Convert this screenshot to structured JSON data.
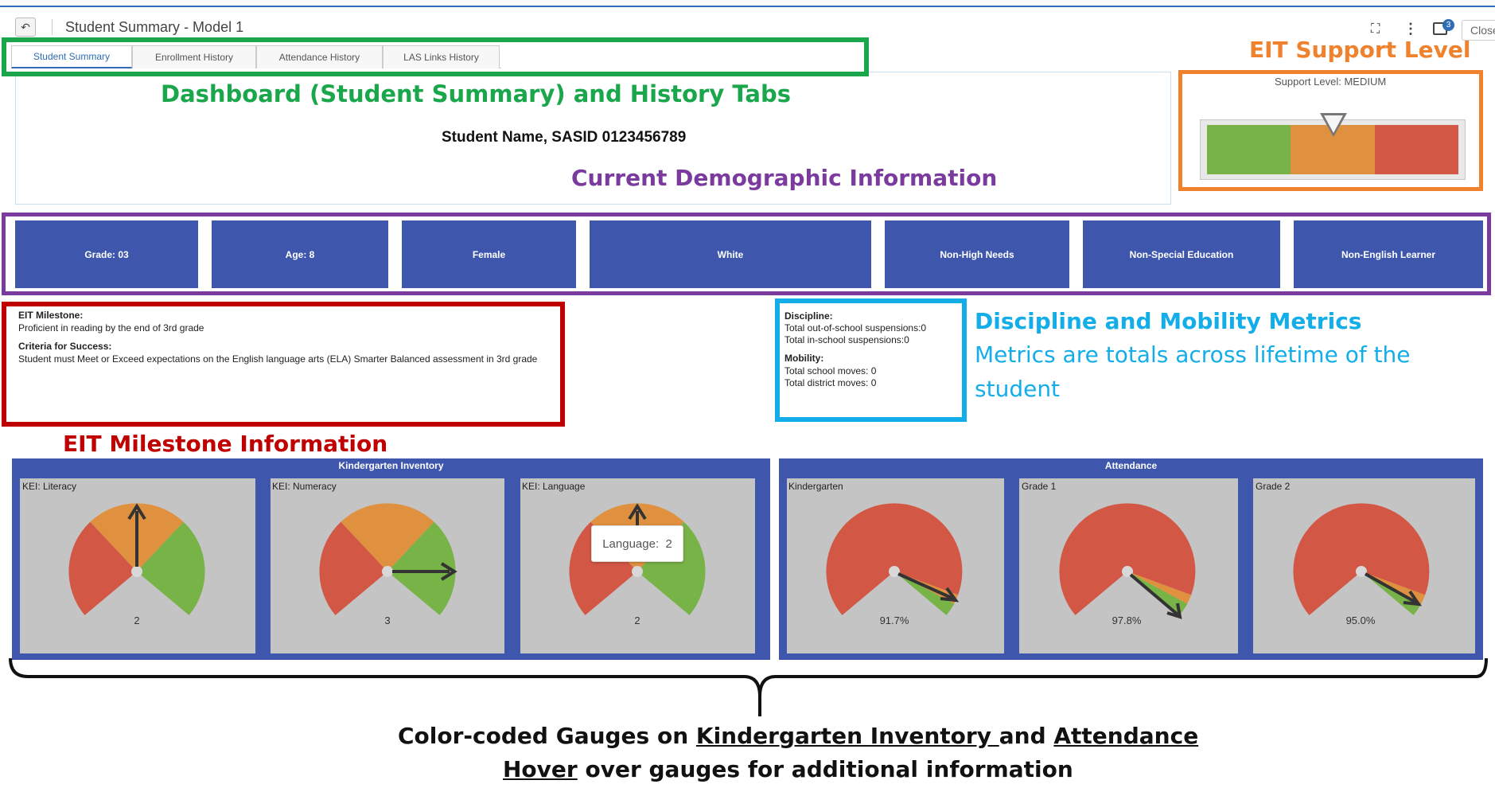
{
  "window": {
    "title": "Student Summary - Model 1",
    "back_icon": "↶",
    "expand_icon": "⛶",
    "more_icon": "⋮",
    "notification_count": "3",
    "close_label": "Close"
  },
  "tabs": [
    {
      "label": "Student Summary",
      "active": true
    },
    {
      "label": "Enrollment History",
      "active": false
    },
    {
      "label": "Attendance History",
      "active": false
    },
    {
      "label": "LAS Links History",
      "active": false
    }
  ],
  "student": {
    "name": "Student Name, SASID 0123456789"
  },
  "support": {
    "label": "Support Level: MEDIUM",
    "level": "MEDIUM"
  },
  "demographics": [
    "Grade: 03",
    "Age: 8",
    "Female",
    "White",
    "Non-High Needs",
    "Non-Special Education",
    "Non-English Learner"
  ],
  "milestone": {
    "title": "EIT Milestone:",
    "text": "Proficient in reading by the end of 3rd grade",
    "criteria_title": "Criteria for Success:",
    "criteria_text": "Student must Meet or Exceed expectations on the English language arts (ELA) Smarter Balanced assessment in 3rd grade"
  },
  "discipline": {
    "title": "Discipline:",
    "out_of_school": "Total out-of-school suspensions:0",
    "in_school": "Total in-school suspensions:0",
    "mobility_title": "Mobility:",
    "school_moves": "Total school moves: 0",
    "district_moves": "Total district moves: 0"
  },
  "kindergarten": {
    "title": "Kindergarten Inventory",
    "gauges": [
      {
        "label": "KEI: Literacy",
        "value": "2"
      },
      {
        "label": "KEI: Numeracy",
        "value": "3"
      },
      {
        "label": "KEI: Language",
        "value": "2"
      }
    ],
    "tooltip": "Language:  2"
  },
  "attendance": {
    "title": "Attendance",
    "gauges": [
      {
        "label": "Kindergarten",
        "value": "91.7%"
      },
      {
        "label": "Grade 1",
        "value": "97.8%"
      },
      {
        "label": "Grade 2",
        "value": "95.0%"
      }
    ]
  },
  "annotations": {
    "tabs": "Dashboard (Student Summary) and History Tabs",
    "support": "EIT Support Level",
    "demographic": "Current Demographic Information",
    "discipline_title": "Discipline and Mobility Metrics",
    "discipline_sub1": "Metrics are totals across lifetime of the",
    "discipline_sub2": "student",
    "milestone": "EIT Milestone Information",
    "caption1_a": "Color-coded Gauges on ",
    "caption1_b": "Kindergarten Inventory ",
    "caption1_c": "and ",
    "caption1_d": "Attendance",
    "caption2_a": "Hover",
    "caption2_b": " over gauges for additional information"
  },
  "colors": {
    "green": "#78b348",
    "orange": "#e0913f",
    "red": "#d35745",
    "panel_blue": "#3e57ad",
    "annotation_green": "#1aa74b",
    "annotation_orange": "#f0822e",
    "annotation_purple": "#7a3a9e",
    "annotation_red": "#c00000",
    "annotation_cyan": "#13aee9"
  }
}
